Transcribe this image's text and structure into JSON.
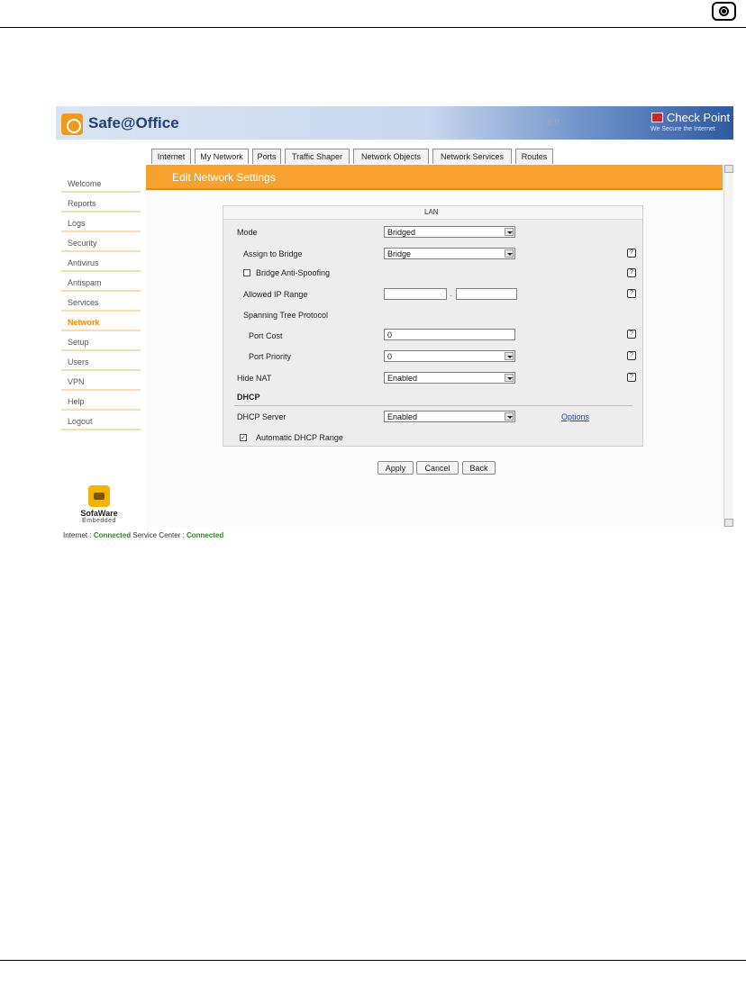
{
  "app": {
    "brand": "Safe@Office",
    "version": "8.0",
    "vendor": "Check Point",
    "vendor_tagline": "We Secure the Internet"
  },
  "sidebar": {
    "items": [
      {
        "label": "Welcome"
      },
      {
        "label": "Reports"
      },
      {
        "label": "Logs"
      },
      {
        "label": "Security"
      },
      {
        "label": "Antivirus"
      },
      {
        "label": "Antispam"
      },
      {
        "label": "Services"
      },
      {
        "label": "Network",
        "active": true
      },
      {
        "label": "Setup"
      },
      {
        "label": "Users"
      },
      {
        "label": "VPN"
      },
      {
        "label": "Help"
      },
      {
        "label": "Logout"
      }
    ],
    "logo_name": "SofaWare",
    "logo_sub": "Embedded"
  },
  "tabs": [
    {
      "label": "Internet"
    },
    {
      "label": "My Network",
      "active": true
    },
    {
      "label": "Ports"
    },
    {
      "label": "Traffic Shaper"
    },
    {
      "label": "Network Objects"
    },
    {
      "label": "Network Services"
    },
    {
      "label": "Routes"
    }
  ],
  "page": {
    "title": "Edit Network Settings"
  },
  "form": {
    "section": "LAN",
    "mode": {
      "label": "Mode",
      "value": "Bridged"
    },
    "assign_to_bridge": {
      "label": "Assign to Bridge",
      "value": "Bridge"
    },
    "anti_spoofing": {
      "label": "Bridge Anti-Spoofing",
      "checked": false
    },
    "allowed_ip_range": {
      "label": "Allowed IP Range",
      "from": "",
      "to": "",
      "separator": "-"
    },
    "stp": {
      "label": "Spanning Tree Protocol"
    },
    "port_cost": {
      "label": "Port Cost",
      "value": "0"
    },
    "port_priority": {
      "label": "Port Priority",
      "value": "0"
    },
    "hide_nat": {
      "label": "Hide NAT",
      "value": "Enabled"
    },
    "dhcp_section": "DHCP",
    "dhcp_server": {
      "label": "DHCP Server",
      "value": "Enabled",
      "options_link": "Options"
    },
    "auto_dhcp": {
      "label": "Automatic DHCP Range",
      "checked": true
    },
    "help_glyph": "?",
    "check_glyph": "✓"
  },
  "buttons": {
    "apply": "Apply",
    "cancel": "Cancel",
    "back": "Back"
  },
  "status_bar": {
    "internet_label": "Internet :",
    "internet_value": "Connected",
    "service_label": "Service Center :",
    "service_value": "Connected"
  },
  "colors": {
    "accent": "#f7a22f",
    "active_nav": "#f08a00",
    "status_ok": "#2b8a20",
    "link": "#1a45c7"
  }
}
